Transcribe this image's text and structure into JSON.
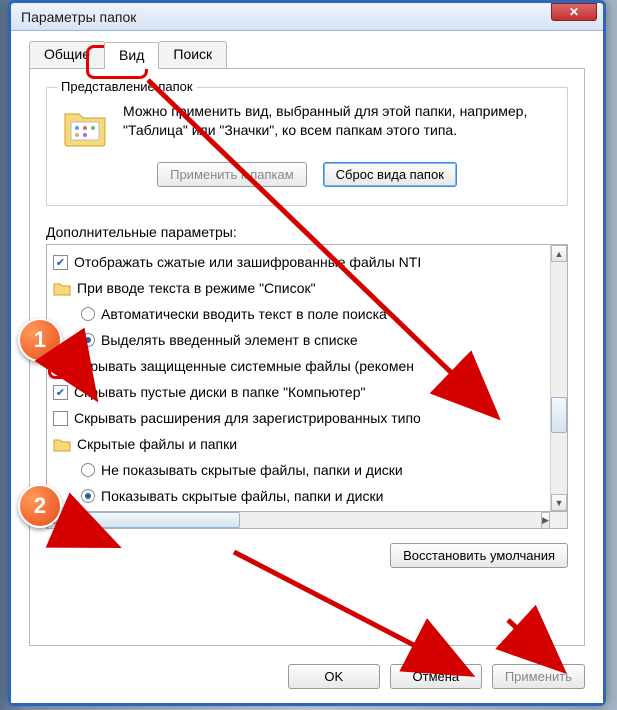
{
  "window_title": "Параметры папок",
  "close_glyph": "✕",
  "tabs": {
    "general": "Общие",
    "view": "Вид",
    "search": "Поиск"
  },
  "folderviews": {
    "legend": "Представление папок",
    "text": "Можно применить вид, выбранный для этой папки, например, \"Таблица\" или \"Значки\", ко всем папкам этого типа.",
    "apply_btn": "Применить к папкам",
    "reset_btn": "Сброс вида папок"
  },
  "advanced_label": "Дополнительные параметры:",
  "tree": {
    "cb_encrypted": "Отображать сжатые или зашифрованные файлы NTI",
    "folder_input": "При вводе текста в режиме \"Список\"",
    "rb_auto_search": "Автоматически вводить текст в поле поиска",
    "rb_highlight_item": "Выделять введенный элемент в списке",
    "cb_hide_protected": "Скрывать защищенные системные файлы (рекомен",
    "cb_hide_empty": "Скрывать пустые диски в папке \"Компьютер\"",
    "cb_hide_ext": "Скрывать расширения для зарегистрированных типо",
    "folder_hidden": "Скрытые файлы и папки",
    "rb_hide_hidden": "Не показывать скрытые файлы, папки и диски",
    "rb_show_hidden": "Показывать скрытые файлы, папки и диски"
  },
  "restore_btn": "Восстановить умолчания",
  "footer": {
    "ok": "OK",
    "cancel": "Отмена",
    "apply": "Применить"
  },
  "callouts": {
    "one": "1",
    "two": "2"
  }
}
